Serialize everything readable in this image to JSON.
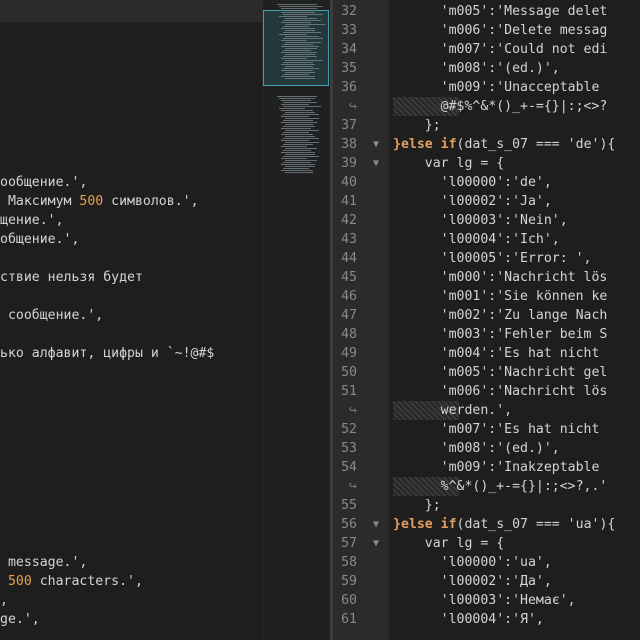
{
  "left_editor": {
    "lines": [
      {
        "row": 9,
        "text": "ообщение.',"
      },
      {
        "row": 10,
        "pre": " Максимум ",
        "num": "500",
        "post": " символов.',"
      },
      {
        "row": 11,
        "text": "щение.',"
      },
      {
        "row": 12,
        "text": "общение.',"
      },
      {
        "row": 14,
        "text": "ствие нельзя будет"
      },
      {
        "row": 16,
        "text": " сообщение.',"
      },
      {
        "row": 18,
        "text": "ько алфавит, цифры и `~!@#$"
      },
      {
        "row": 29,
        "text": " message.',"
      },
      {
        "row": 30,
        "pre": " ",
        "num": "500",
        "post": " characters.',"
      },
      {
        "row": 31,
        "text": ","
      },
      {
        "row": 32,
        "text": "ge.',"
      }
    ]
  },
  "right_editor": {
    "lines": [
      {
        "n": "32",
        "text": "      'm005':'Message delet"
      },
      {
        "n": "33",
        "text": "      'm006':'Delete messag"
      },
      {
        "n": "34",
        "text": "      'm007':'Could not edi"
      },
      {
        "n": "35",
        "text": "      'm008':'(ed.)',"
      },
      {
        "n": "36",
        "text": "      'm009':'Unacceptable"
      },
      {
        "n": "↪",
        "wrap": true,
        "text": "      @#$%^&*()_+-={}|:;<>?"
      },
      {
        "n": "37",
        "text": "    };"
      },
      {
        "n": "38",
        "fold": true,
        "kw": "}else if",
        "text": "(dat_s_07 === 'de'){"
      },
      {
        "n": "39",
        "fold": true,
        "text": "    var lg = {"
      },
      {
        "n": "40",
        "text": "      'l00000':'de',"
      },
      {
        "n": "41",
        "text": "      'l00002':'Ja',"
      },
      {
        "n": "42",
        "text": "      'l00003':'Nein',"
      },
      {
        "n": "43",
        "text": "      'l00004':'Ich',"
      },
      {
        "n": "44",
        "text": "      'l00005':'Error: ',"
      },
      {
        "n": "45",
        "text": "      'm000':'Nachricht lös"
      },
      {
        "n": "46",
        "text": "      'm001':'Sie können ke"
      },
      {
        "n": "47",
        "text": "      'm002':'Zu lange Nach"
      },
      {
        "n": "48",
        "text": "      'm003':'Fehler beim S"
      },
      {
        "n": "49",
        "text": "      'm004':'Es hat nicht"
      },
      {
        "n": "50",
        "text": "      'm005':'Nachricht gel"
      },
      {
        "n": "51",
        "text": "      'm006':'Nachricht lös"
      },
      {
        "n": "↪",
        "wrap": true,
        "text": "      werden.',"
      },
      {
        "n": "52",
        "text": "      'm007':'Es hat nicht"
      },
      {
        "n": "53",
        "text": "      'm008':'(ed.)',"
      },
      {
        "n": "54",
        "text": "      'm009':'Inakzeptable"
      },
      {
        "n": "↪",
        "wrap": true,
        "text": "      %^&*()_+-={}|:;<>?,.'"
      },
      {
        "n": "55",
        "text": "    };"
      },
      {
        "n": "56",
        "fold": true,
        "kw": "}else if",
        "text": "(dat_s_07 === 'ua'){"
      },
      {
        "n": "57",
        "fold": true,
        "text": "    var lg = {"
      },
      {
        "n": "58",
        "text": "      'l00000':'ua',"
      },
      {
        "n": "59",
        "text": "      'l00002':'Да',"
      },
      {
        "n": "60",
        "text": "      'l00003':'Немає',"
      },
      {
        "n": "61",
        "text": "      'l00004':'Я',"
      }
    ]
  }
}
